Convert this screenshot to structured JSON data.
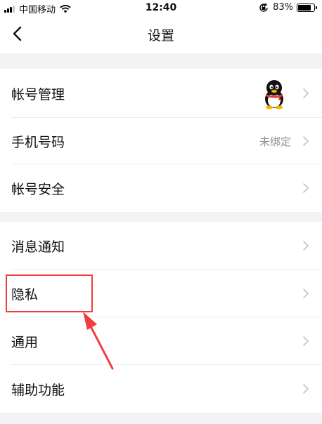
{
  "status_bar": {
    "carrier": "中国移动",
    "time": "12:40",
    "battery": "83%",
    "battery_level": 0.83
  },
  "nav": {
    "title": "设置",
    "back_icon": "chevron-left-icon"
  },
  "sections": [
    {
      "items": [
        {
          "label": "帐号管理",
          "value": "",
          "trailing_icon": "qq-penguin-avatar"
        },
        {
          "label": "手机号码",
          "value": "未绑定"
        },
        {
          "label": "帐号安全",
          "value": ""
        }
      ]
    },
    {
      "items": [
        {
          "label": "消息通知",
          "value": ""
        },
        {
          "label": "隐私",
          "value": "",
          "highlighted": true
        },
        {
          "label": "通用",
          "value": ""
        },
        {
          "label": "辅助功能",
          "value": ""
        }
      ]
    }
  ],
  "colors": {
    "separator_bg": "#f2f3f5",
    "annotation_red": "#f23d3d",
    "secondary_text": "#8e8e93"
  }
}
